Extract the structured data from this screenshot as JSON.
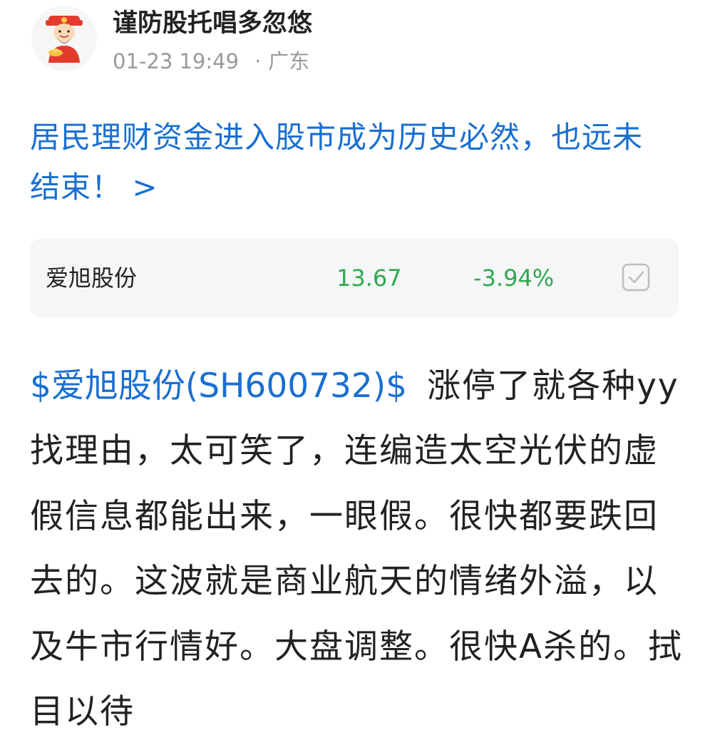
{
  "author": {
    "name": "谨防股托唱多忽悠",
    "time": "01-23 19:49",
    "location_separator": "·",
    "location": "广东",
    "avatar_icon": "god-of-wealth-avatar"
  },
  "post": {
    "title": "居民理财资金进入股市成为历史必然，也远未结束！ >",
    "stock_card": {
      "name": "爱旭股份",
      "price": "13.67",
      "change": "-3.94%",
      "change_color": "#2fa84f",
      "check_icon": "checkbox-icon"
    },
    "mention": "$爱旭股份(SH600732)$",
    "body": "涨停了就各种yy找理由，太可笑了，连编造太空光伏的虚假信息都能出来，一眼假。很快都要跌回去的。这波就是商业航天的情绪外溢，以及牛市行情好。大盘调整。很快A杀的。拭目以待"
  },
  "colors": {
    "link": "#1a6fd1",
    "text": "#222222",
    "muted": "#9a9a9a",
    "card_bg": "#f5f6f8"
  }
}
